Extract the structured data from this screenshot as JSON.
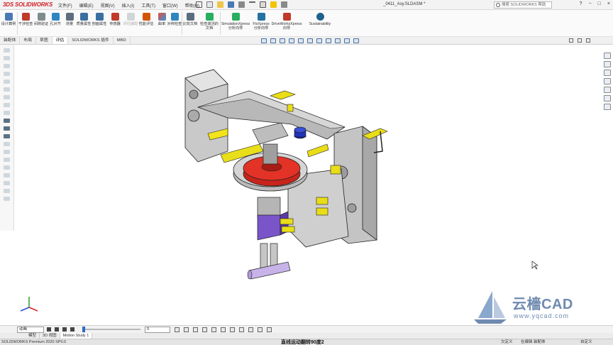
{
  "app": {
    "logo": "SOLIDWORKS",
    "logo_prefix": "3DS",
    "document_title": "_0411_Asy.SLDASM *"
  },
  "menu": [
    "文件(F)",
    "编辑(E)",
    "视图(V)",
    "插入(I)",
    "工具(T)",
    "窗口(W)",
    "帮助(H)"
  ],
  "search": {
    "placeholder": "搜索 SOLIDWORKS 帮助"
  },
  "window_controls": [
    "?",
    "−",
    "□",
    "×"
  ],
  "ribbon": [
    {
      "label": "设计算例",
      "icon": "design-study-icon",
      "color": "#4a78b5"
    },
    {
      "label": "干涉检查",
      "icon": "interference-icon",
      "color": "#c0392b"
    },
    {
      "label": "间隙验证",
      "icon": "clearance-icon",
      "color": "#7f8c8d"
    },
    {
      "label": "孔对齐",
      "icon": "hole-align-icon",
      "color": "#2e86c1"
    },
    {
      "label": "测量",
      "icon": "measure-icon",
      "color": "#5d6d7e"
    },
    {
      "label": "质量属性",
      "icon": "mass-properties-icon",
      "color": "#3b6fa0"
    },
    {
      "label": "剖面属性",
      "icon": "section-properties-icon",
      "color": "#3b6fa0"
    },
    {
      "label": "传感器",
      "icon": "sensor-icon",
      "color": "#c0392b"
    },
    {
      "label": "评估装配",
      "icon": "evaluate-assembly-icon",
      "color": "#aab7b8"
    },
    {
      "label": "性能评估",
      "icon": "performance-icon",
      "color": "#d35400"
    },
    {
      "label": "曲率",
      "icon": "curvature-icon",
      "color": "#8e44ad"
    },
    {
      "label": "对称检查",
      "icon": "symmetry-check-icon",
      "color": "#2e86c1"
    },
    {
      "label": "比较文档",
      "icon": "compare-icon",
      "color": "#5d6d7e"
    },
    {
      "label": "检查激活的文档",
      "icon": "check-doc-icon",
      "color": "#27ae60"
    },
    {
      "label": "SimulationXpress 分析向导",
      "icon": "simulationxpress-icon",
      "color": "#27ae60"
    },
    {
      "label": "FloXpress 分析向导",
      "icon": "floxpress-icon",
      "color": "#2471a3"
    },
    {
      "label": "DriveWorksXpress 向导",
      "icon": "driveworksxpress-icon",
      "color": "#c0392b"
    },
    {
      "label": "Sustainability",
      "icon": "sustainability-icon",
      "color": "#1f618d"
    }
  ],
  "tabs": [
    "装配体",
    "布局",
    "草图",
    "评估",
    "SOLIDWORKS 插件",
    "MBD"
  ],
  "active_tab": "评估",
  "watermark": {
    "brand": "云檣CAD",
    "url": "www.yqcad.com"
  },
  "animation": {
    "mode": "动画",
    "time": "0"
  },
  "bottom_tabs": [
    "模型",
    "3D 视图",
    "Motion Study 1"
  ],
  "status": {
    "product": "SOLIDWORKS Premium 2020 SP0.0",
    "caption": "直线运动翻转90度2",
    "under_defined": "欠定义",
    "editing": "在编辑 装配体",
    "custom": "自定义"
  }
}
